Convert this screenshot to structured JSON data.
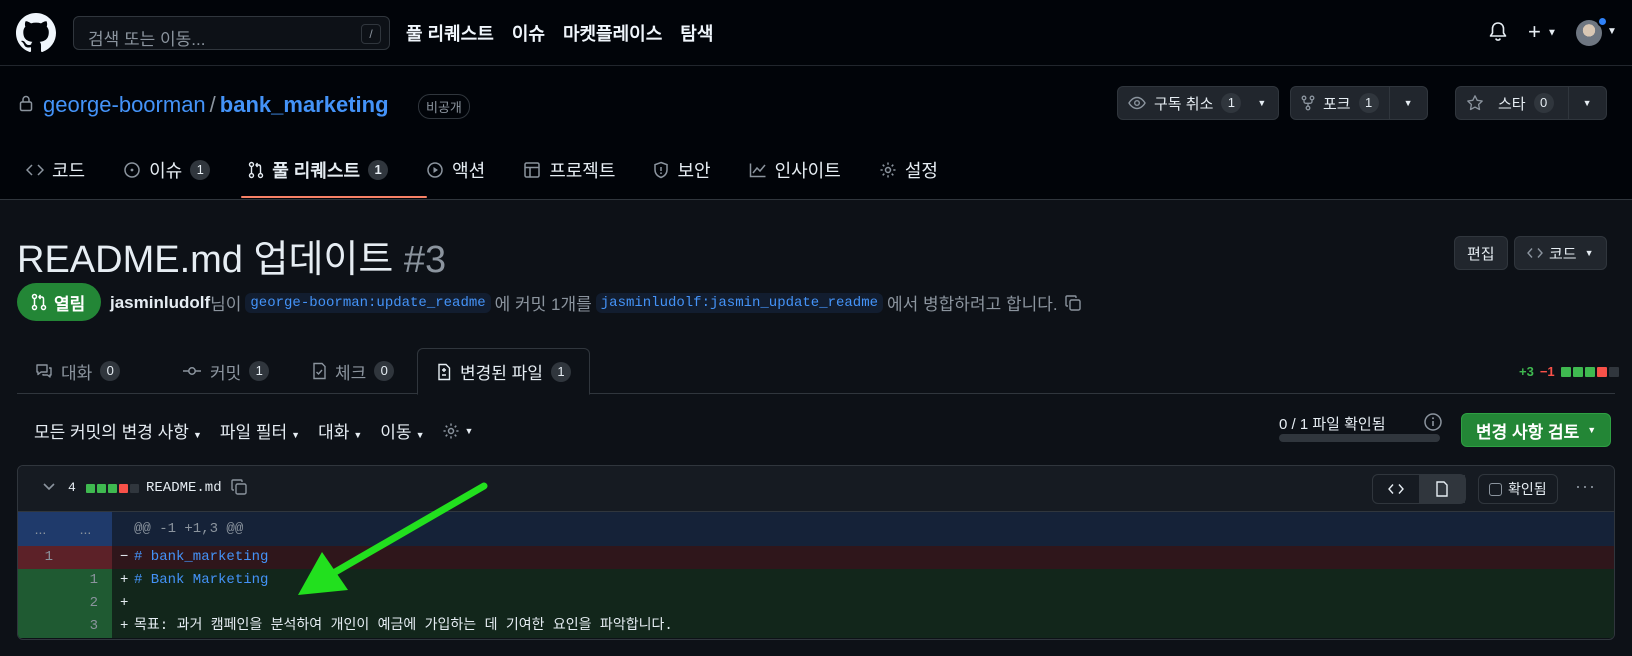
{
  "header": {
    "search_placeholder": "검색 또는 이동...",
    "search_key": "/",
    "nav": [
      "풀 리퀘스트",
      "이슈",
      "마켓플레이스",
      "탐색"
    ],
    "plus": "+"
  },
  "repo": {
    "owner": "george-boorman",
    "separator": "/",
    "name": "bank_marketing",
    "visibility": "비공개",
    "watch": {
      "label": "구독 취소",
      "count": "1"
    },
    "fork": {
      "label": "포크",
      "count": "1"
    },
    "star": {
      "label": "스타",
      "count": "0"
    },
    "tabs": [
      {
        "label": "코드",
        "icon": "code-icon"
      },
      {
        "label": "이슈",
        "icon": "issue-icon",
        "count": "1"
      },
      {
        "label": "풀 리퀘스트",
        "icon": "pull-request-icon",
        "count": "1",
        "active": true
      },
      {
        "label": "액션",
        "icon": "play-icon"
      },
      {
        "label": "프로젝트",
        "icon": "table-icon"
      },
      {
        "label": "보안",
        "icon": "shield-icon"
      },
      {
        "label": "인사이트",
        "icon": "graph-icon"
      },
      {
        "label": "설정",
        "icon": "gear-icon"
      }
    ]
  },
  "pr": {
    "title": "README.md 업데이트",
    "number": "#3",
    "edit": "편집",
    "code": "코드",
    "state": "열림",
    "author": "jasminludolf",
    "meta_1": "님이",
    "base_branch": "george-boorman:update_readme",
    "meta_2": "에 커밋 1개를",
    "head_branch": "jasminludolf:jasmin_update_readme",
    "meta_3": "에서 병합하려고 합니다.",
    "tabs": [
      {
        "label": "대화",
        "count": "0",
        "icon": "comment-icon"
      },
      {
        "label": "커밋",
        "count": "1",
        "icon": "commit-icon"
      },
      {
        "label": "체크",
        "count": "0",
        "icon": "checklist-icon"
      },
      {
        "label": "변경된 파일",
        "count": "1",
        "icon": "file-diff-icon",
        "active": true
      }
    ],
    "additions": "+3",
    "deletions": "−1"
  },
  "toolbar": {
    "commits": "모든 커밋의 변경 사항",
    "filter": "파일 필터",
    "conversations": "대화",
    "jump": "이동",
    "viewed": "0 / 1 파일 확인됨",
    "viewed_fraction": 0,
    "review": "변경 사항 검토"
  },
  "file": {
    "changes": "4",
    "name": "README.md",
    "viewed": "확인됨",
    "hunk_left": "...",
    "hunk_right": "...",
    "hunk": "@@ -1 +1,3 @@",
    "lines": [
      {
        "type": "del",
        "old": "1",
        "new": "",
        "mark": "−",
        "text": "# bank_marketing"
      },
      {
        "type": "add",
        "old": "",
        "new": "1",
        "mark": "+",
        "text": "# Bank Marketing"
      },
      {
        "type": "add",
        "old": "",
        "new": "2",
        "mark": "+",
        "text": ""
      },
      {
        "type": "add",
        "old": "",
        "new": "3",
        "mark": "+",
        "text": "목표: 과거 캠페인을 분석하여 개인이 예금에 가입하는 데 기여한 요인을 파악합니다."
      }
    ]
  },
  "colors": {
    "accent": "#4493f8",
    "open": "#238636",
    "annotation_arrow": "#22e01e"
  }
}
